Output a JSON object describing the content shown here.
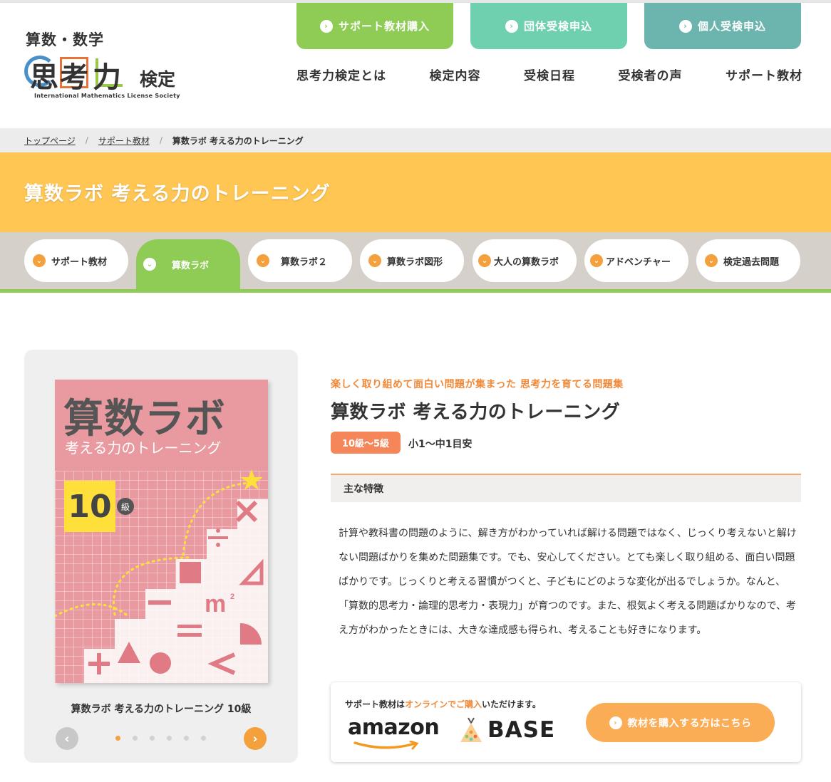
{
  "header": {
    "logo": {
      "top": "算数・数学",
      "main": "思考力",
      "suffix": "検定",
      "org": "International Mathematics License Society"
    },
    "top_buttons": [
      {
        "label": "サポート教材購入"
      },
      {
        "label": "団体受検申込"
      },
      {
        "label": "個人受検申込"
      }
    ],
    "nav": [
      "思考力検定とは",
      "検定内容",
      "受検日程",
      "受検者の声",
      "サポート教材"
    ]
  },
  "breadcrumb": {
    "items": [
      "トップページ",
      "サポート教材"
    ],
    "current": "算数ラボ 考える力のトレーニング",
    "separator": "/"
  },
  "banner": {
    "title": "算数ラボ 考える力のトレーニング"
  },
  "tabs": [
    "サポート教材",
    "算数ラボ",
    "算数ラボ２",
    "算数ラボ図形",
    "大人の算数ラボ",
    "アドベンチャー",
    "検定過去問題"
  ],
  "active_tab": "算数ラボ",
  "product": {
    "cover": {
      "title": "算数ラボ",
      "subtitle": "考える力のトレーニング",
      "level_number": "10",
      "level_unit": "級"
    },
    "caption": "算数ラボ 考える力のトレーニング 10級",
    "slides": 6,
    "current_slide": 1,
    "catch": "楽しく取り組めて面白い問題が集まった 思考力を育てる問題集",
    "title": "算数ラボ 考える力のトレーニング",
    "level_badge": "10級〜5級",
    "level_note": "小1〜中1目安",
    "features_heading": "主な特徴",
    "description": "計算や教科書の問題のように、解き方がわかっていれば解ける問題ではなく、じっくり考えないと解けない問題ばかりを集めた問題集です。でも、安心してください。とても楽しく取り組める、面白い問題ばかりです。じっくりと考える習慣がつくと、子どもにどのような変化が出るでしょうか。なんと、「算数的思考力・論理的思考力・表現力」が育つのです。また、根気よく考える問題ばかりなので、考え方がわかったときには、大きな達成感も得られ、考えることも好きになります。"
  },
  "purchase": {
    "text_before": "サポート教材は",
    "text_highlight": "オンラインでご購入",
    "text_after": "いただけます。",
    "store1": "amazon",
    "store2": "BASE",
    "button": "教材を購入する方はこちら"
  },
  "colors": {
    "green": "#8fcc55",
    "mint": "#6fd0b0",
    "teal": "#6cb5ae",
    "yellow": "#ffc653",
    "orange": "#f4a03c",
    "salmon": "#f5865a",
    "book_pink": "#e89aa0"
  },
  "icons": [
    "chevron-right-circle-icon",
    "chevron-down-circle-icon",
    "arrow-left-icon",
    "arrow-right-icon"
  ]
}
